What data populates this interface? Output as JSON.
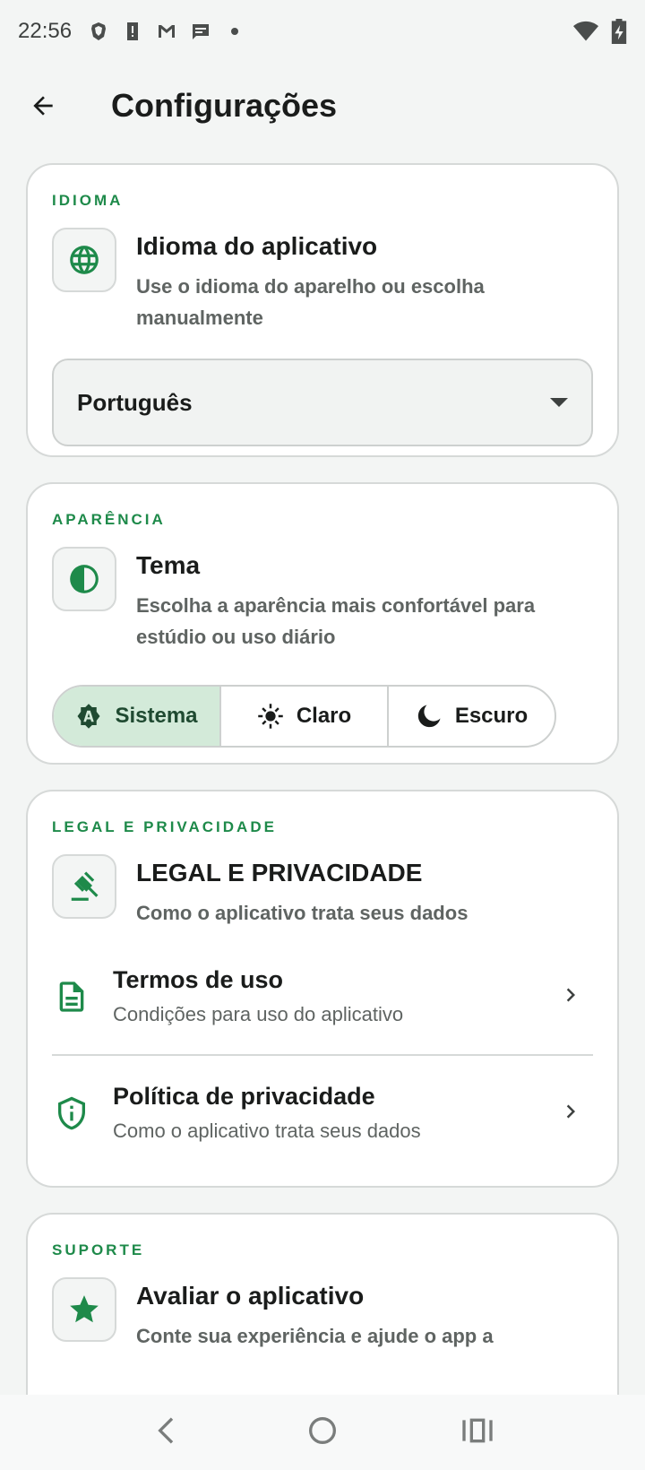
{
  "status_bar": {
    "time": "22:56",
    "icons": [
      "brave-icon",
      "alert-icon",
      "gmail-icon",
      "message-icon",
      "dot-icon"
    ],
    "right_icons": [
      "wifi-icon",
      "battery-charging-icon"
    ]
  },
  "app_bar": {
    "title": "Configurações"
  },
  "language_card": {
    "section_label": "IDIOMA",
    "title": "Idioma do aplicativo",
    "subtitle": "Use o idioma do aparelho ou escolha manualmente",
    "icon": "globe-icon",
    "selected_value": "Português"
  },
  "appearance_card": {
    "section_label": "APARÊNCIA",
    "title": "Tema",
    "subtitle": "Escolha a aparência mais confortável para estúdio ou uso diário",
    "icon": "contrast-icon",
    "options": [
      {
        "label": "Sistema",
        "icon": "auto-theme-icon",
        "selected": true
      },
      {
        "label": "Claro",
        "icon": "sun-icon",
        "selected": false
      },
      {
        "label": "Escuro",
        "icon": "moon-icon",
        "selected": false
      }
    ]
  },
  "legal_card": {
    "section_label": "LEGAL E PRIVACIDADE",
    "title": "LEGAL E PRIVACIDADE",
    "subtitle": "Como o aplicativo trata seus dados",
    "icon": "gavel-icon",
    "items": [
      {
        "title": "Termos de uso",
        "subtitle": "Condições para uso do aplicativo",
        "icon": "document-icon"
      },
      {
        "title": "Política de privacidade",
        "subtitle": "Como o aplicativo trata seus dados",
        "icon": "shield-info-icon"
      }
    ]
  },
  "support_card": {
    "section_label": "SUPORTE",
    "title": "Avaliar o aplicativo",
    "subtitle": "Conte sua experiência e ajude o app a",
    "icon": "star-icon"
  },
  "colors": {
    "accent": "#1e8a4a",
    "background": "#f3f5f4",
    "selected_segment": "#d3ead9"
  }
}
